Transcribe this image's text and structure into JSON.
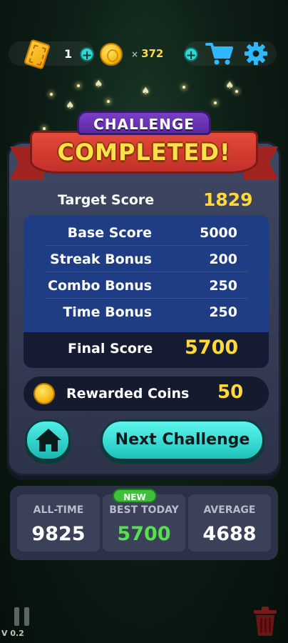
{
  "top_bar": {
    "tickets": "1",
    "coins": "372",
    "coins_prefix": "×"
  },
  "banner": {
    "line1": "CHALLENGE",
    "line2": "COMPLETED!"
  },
  "results": {
    "target_label": "Target Score",
    "target_value": "1829",
    "rows": [
      {
        "label": "Base Score",
        "value": "5000"
      },
      {
        "label": "Streak Bonus",
        "value": "200"
      },
      {
        "label": "Combo Bonus",
        "value": "250"
      },
      {
        "label": "Time Bonus",
        "value": "250"
      }
    ],
    "final_label": "Final Score",
    "final_value": "5700",
    "reward_label": "Rewarded Coins",
    "reward_value": "50"
  },
  "actions": {
    "next_label": "Next Challenge"
  },
  "stats": {
    "new_badge": "NEW",
    "all_time_label": "ALL-TIME",
    "all_time_value": "9825",
    "best_today_label": "BEST TODAY",
    "best_today_value": "5700",
    "average_label": "AVERAGE",
    "average_value": "4688"
  },
  "footer": {
    "version": "V 0.2"
  },
  "colors": {
    "accent_gold": "#ffd83a",
    "accent_cyan": "#2fd8d0",
    "best_green": "#56e04e",
    "ribbon_red": "#c5302a",
    "panel_bg": "#3f4763"
  },
  "icons": [
    "ticket-icon",
    "plus-icon",
    "coin-icon",
    "cart-icon",
    "gear-icon",
    "home-icon",
    "pause-icon",
    "trash-icon"
  ]
}
